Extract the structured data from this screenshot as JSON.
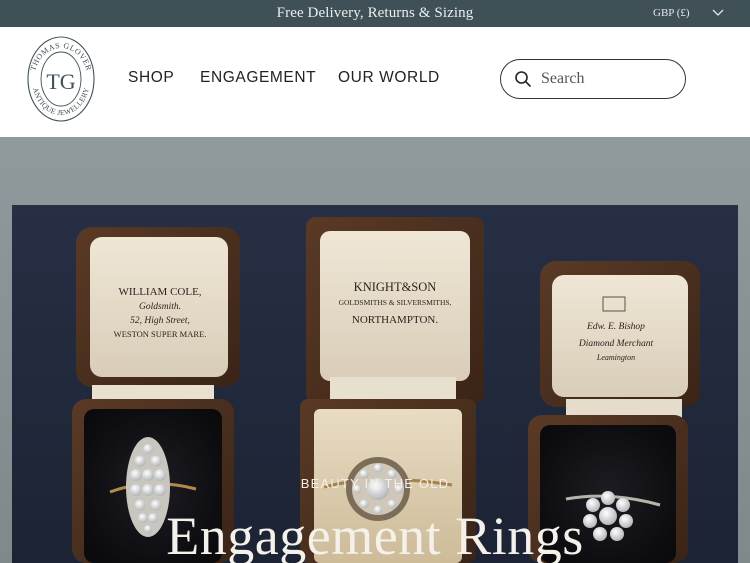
{
  "announcement": {
    "text": "Free Delivery, Returns & Sizing",
    "currency": "GBP (£)",
    "currency_icon": "chevron-down-icon"
  },
  "logo": {
    "monogram": "TG",
    "ring_text_top": "THOMAS GLOVER",
    "ring_text_bottom": "ANTIQUE JEWELLERY"
  },
  "nav": {
    "items": [
      {
        "label": "SHOP"
      },
      {
        "label": "ENGAGEMENT"
      },
      {
        "label": "OUR WORLD"
      }
    ]
  },
  "search": {
    "placeholder": "Search",
    "icon": "search-icon"
  },
  "hero": {
    "eyebrow": "BEAUTY IN THE OLD",
    "title": "Engagement Rings",
    "boxes": [
      {
        "lines": [
          "WILLIAM COLE,",
          "Goldsmith.",
          "52, High Street,",
          "WESTON SUPER MARE."
        ]
      },
      {
        "lines": [
          "KNIGHT&SON",
          "GOLDSMITHS & SILVERSMITHS,",
          "NORTHAMPTON."
        ]
      },
      {
        "lines": [
          "Edw. E. Bishop",
          "Diamond Merchant",
          "Leamington"
        ]
      }
    ]
  }
}
